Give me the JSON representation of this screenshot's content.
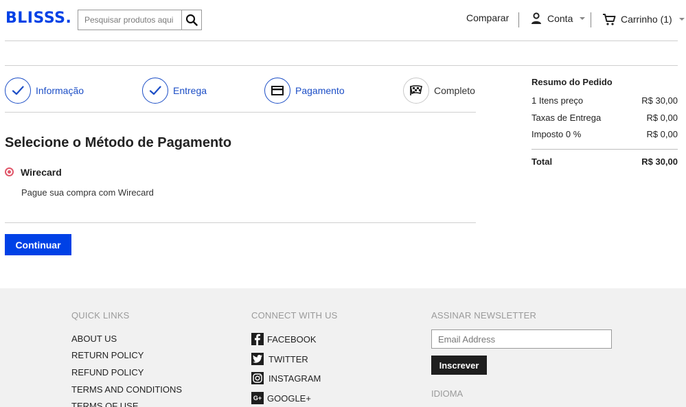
{
  "header": {
    "logo": "BLISSS.",
    "search_placeholder": "Pesquisar produtos aqui",
    "compare": "Comparar",
    "account": "Conta",
    "cart": "Carrinho (1)"
  },
  "steps": [
    {
      "label": "Informação",
      "state": "done",
      "icon": "check-icon"
    },
    {
      "label": "Entrega",
      "state": "done",
      "icon": "check-icon"
    },
    {
      "label": "Pagamento",
      "state": "active",
      "icon": "card-icon"
    },
    {
      "label": "Completo",
      "state": "pending",
      "icon": "checkered-flag-icon"
    }
  ],
  "payment": {
    "title": "Selecione o Método de Pagamento",
    "method_name": "Wirecard",
    "method_desc": "Pague sua compra com Wirecard",
    "continue": "Continuar"
  },
  "summary": {
    "title": "Resumo do Pedido",
    "rows": [
      {
        "label": "1 Itens preço",
        "value": "R$ 30,00"
      },
      {
        "label": "Taxas de Entrega",
        "value": "R$ 0,00"
      },
      {
        "label": "Imposto 0 %",
        "value": "R$ 0,00"
      }
    ],
    "total_label": "Total",
    "total_value": "R$ 30,00"
  },
  "footer": {
    "quick_links_heading": "QUICK LINKS",
    "quick_links": [
      "ABOUT US",
      "RETURN POLICY",
      "REFUND POLICY",
      "TERMS AND CONDITIONS",
      "TERMS OF USE"
    ],
    "connect_heading": "CONNECT WITH US",
    "social": [
      {
        "label": "FACEBOOK",
        "icon": "facebook-icon"
      },
      {
        "label": "TWITTER",
        "icon": "twitter-icon"
      },
      {
        "label": "INSTAGRAM",
        "icon": "instagram-icon"
      },
      {
        "label": "GOOGLE+",
        "icon": "google-plus-icon"
      }
    ],
    "newsletter_heading": "ASSINAR NEWSLETTER",
    "email_placeholder": "Email Address",
    "subscribe": "Inscrever",
    "language_heading": "IDIOMA"
  },
  "colors": {
    "brand": "#0041e6",
    "step_accent": "#1c4ec6",
    "radio": "#e0576a",
    "footer_bg": "#f1f1f1"
  }
}
